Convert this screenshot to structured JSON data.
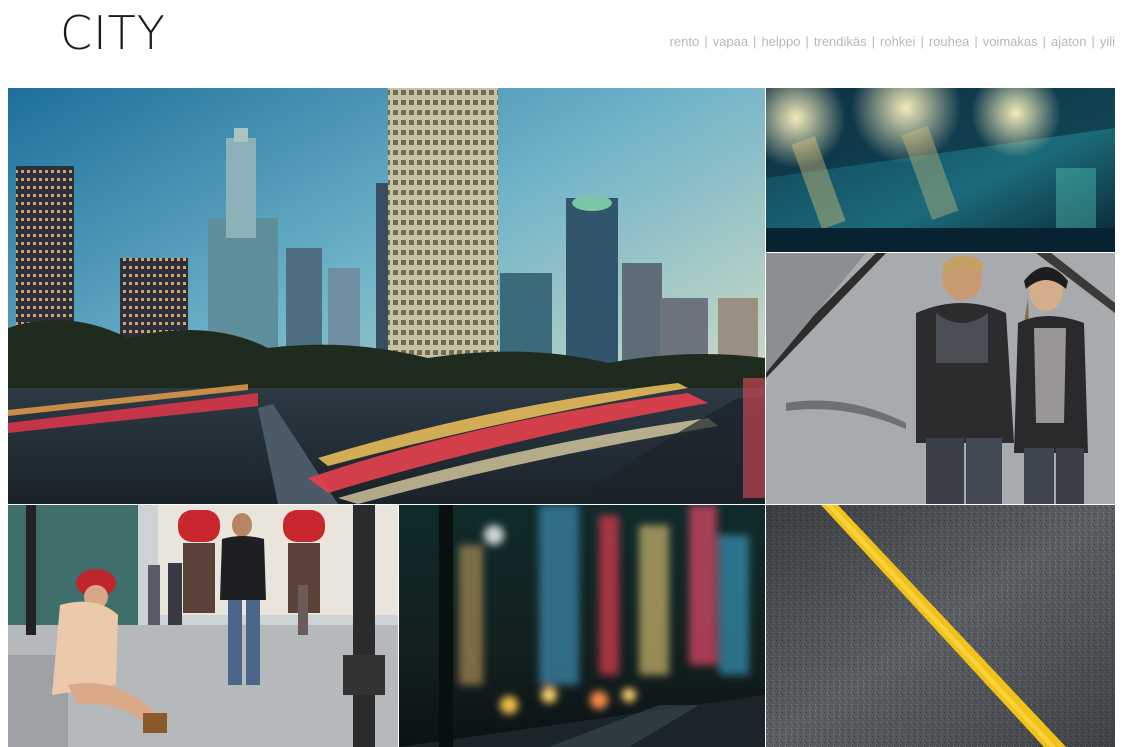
{
  "header": {
    "logo": "CITY",
    "nav": [
      "rento",
      "vapaa",
      "helppo",
      "trendikäs",
      "rohkei",
      "rouhea",
      "voimakas",
      "ajaton",
      "yili"
    ],
    "separator": "|"
  },
  "gallery": {
    "tiles": [
      {
        "name": "skyline-photo",
        "subject": "city skyline with light trails"
      },
      {
        "name": "night-lights-photo",
        "subject": "night street lights"
      },
      {
        "name": "fashion-couple-photo",
        "subject": "couple on the street"
      },
      {
        "name": "street-sitting-photo",
        "subject": "woman sitting on street"
      },
      {
        "name": "blurred-city-night-photo",
        "subject": "blurred night street"
      },
      {
        "name": "asphalt-yellow-line-photo",
        "subject": "asphalt with yellow line"
      }
    ]
  },
  "colors": {
    "logo": "#1a1a1a",
    "nav_text": "#b8b8b8",
    "background": "#ffffff"
  }
}
